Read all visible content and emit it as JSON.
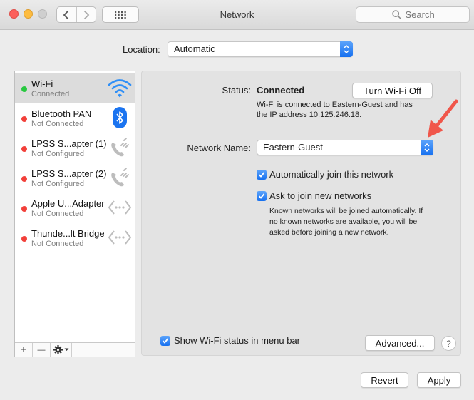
{
  "window": {
    "title": "Network",
    "search_placeholder": "Search"
  },
  "location": {
    "label": "Location:",
    "value": "Automatic"
  },
  "services": [
    {
      "name": "Wi-Fi",
      "status": "Connected",
      "status_color": "#28c840",
      "icon": "wifi-icon",
      "selected": true
    },
    {
      "name": "Bluetooth PAN",
      "status": "Not Connected",
      "status_color": "#f2403a",
      "icon": "bluetooth-icon"
    },
    {
      "name": "LPSS S...apter (1)",
      "status": "Not Configured",
      "status_color": "#f2403a",
      "icon": "phone-icon"
    },
    {
      "name": "LPSS S...apter (2)",
      "status": "Not Configured",
      "status_color": "#f2403a",
      "icon": "phone-icon"
    },
    {
      "name": "Apple U...Adapter",
      "status": "Not Connected",
      "status_color": "#f2403a",
      "icon": "ethernet-icon"
    },
    {
      "name": "Thunde...lt Bridge",
      "status": "Not Connected",
      "status_color": "#f2403a",
      "icon": "ethernet-icon"
    }
  ],
  "sidebar_toolbar": {
    "add": "+",
    "remove": "—"
  },
  "detail": {
    "status_label": "Status:",
    "status_value": "Connected",
    "turn_off_label": "Turn Wi-Fi Off",
    "status_desc_line1": "Wi-Fi is connected to Eastern-Guest and has",
    "status_desc_line2": "the IP address 10.125.246.18.",
    "network_name_label": "Network Name:",
    "network_name_value": "Eastern-Guest",
    "auto_join_label": "Automatically join this network",
    "ask_join_label": "Ask to join new networks",
    "ask_desc_line1": "Known networks will be joined automatically. If",
    "ask_desc_line2": "no known networks are available, you will be",
    "ask_desc_line3": "asked before joining a new network.",
    "show_status_label": "Show Wi-Fi status in menu bar",
    "advanced_label": "Advanced...",
    "help_label": "?"
  },
  "footer": {
    "revert_label": "Revert",
    "apply_label": "Apply"
  },
  "colors": {
    "accent": "#1b74f0",
    "arrow": "#f0564a"
  }
}
